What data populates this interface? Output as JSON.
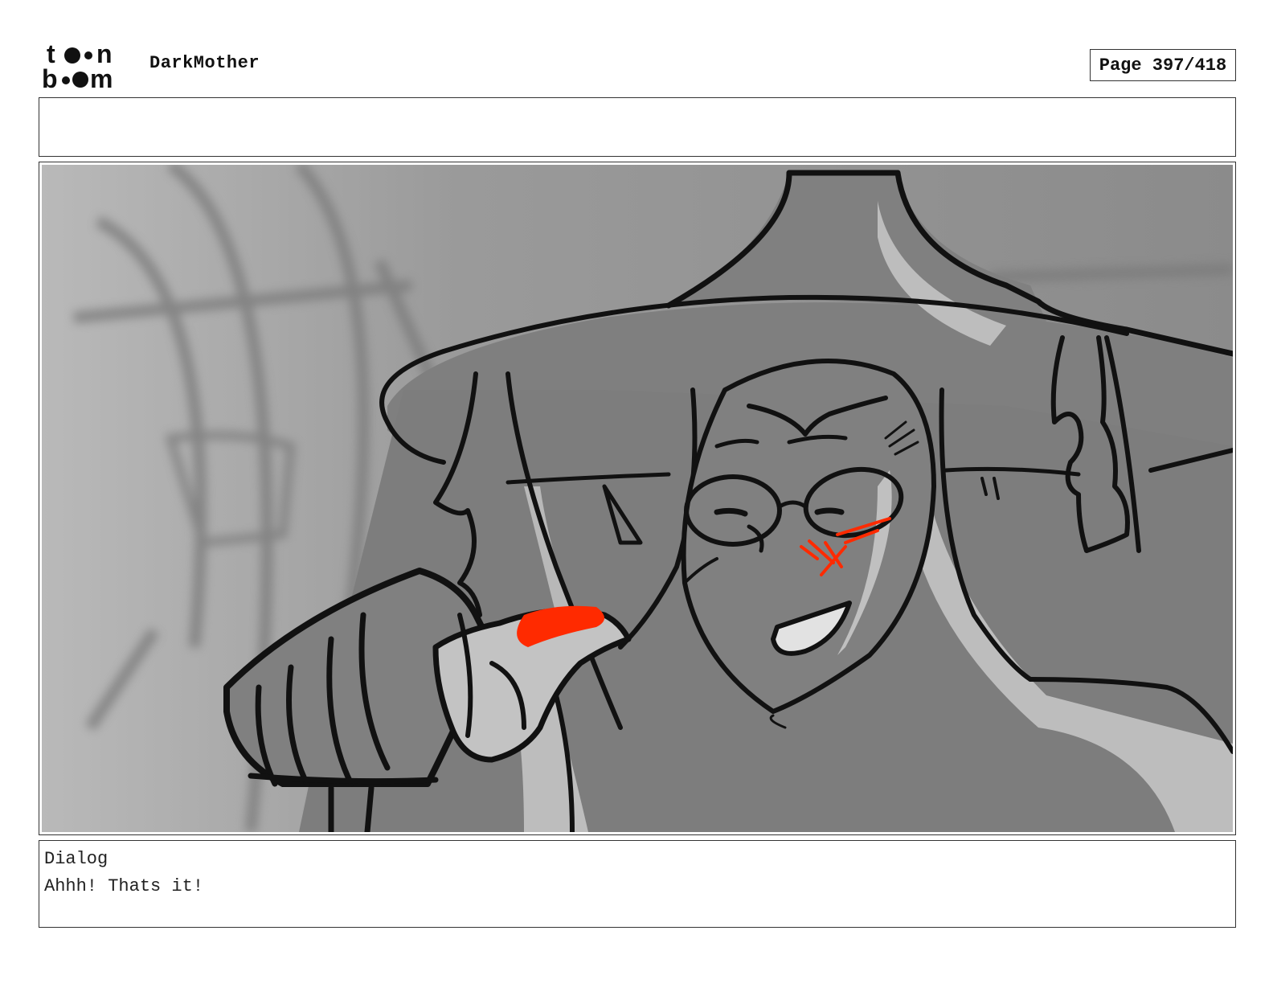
{
  "header": {
    "logo": {
      "line1": "toon",
      "line2": "boom",
      "icon": "toonboom-logo"
    },
    "project_title": "DarkMother",
    "page_label": "Page 397/418"
  },
  "notes": {
    "text": ""
  },
  "panel": {
    "image": "storyboard-sketch-witch-raising-finger",
    "accent_color": "#ff2a00"
  },
  "dialog": {
    "label": "Dialog",
    "text": "Ahhh! Thats it!"
  }
}
